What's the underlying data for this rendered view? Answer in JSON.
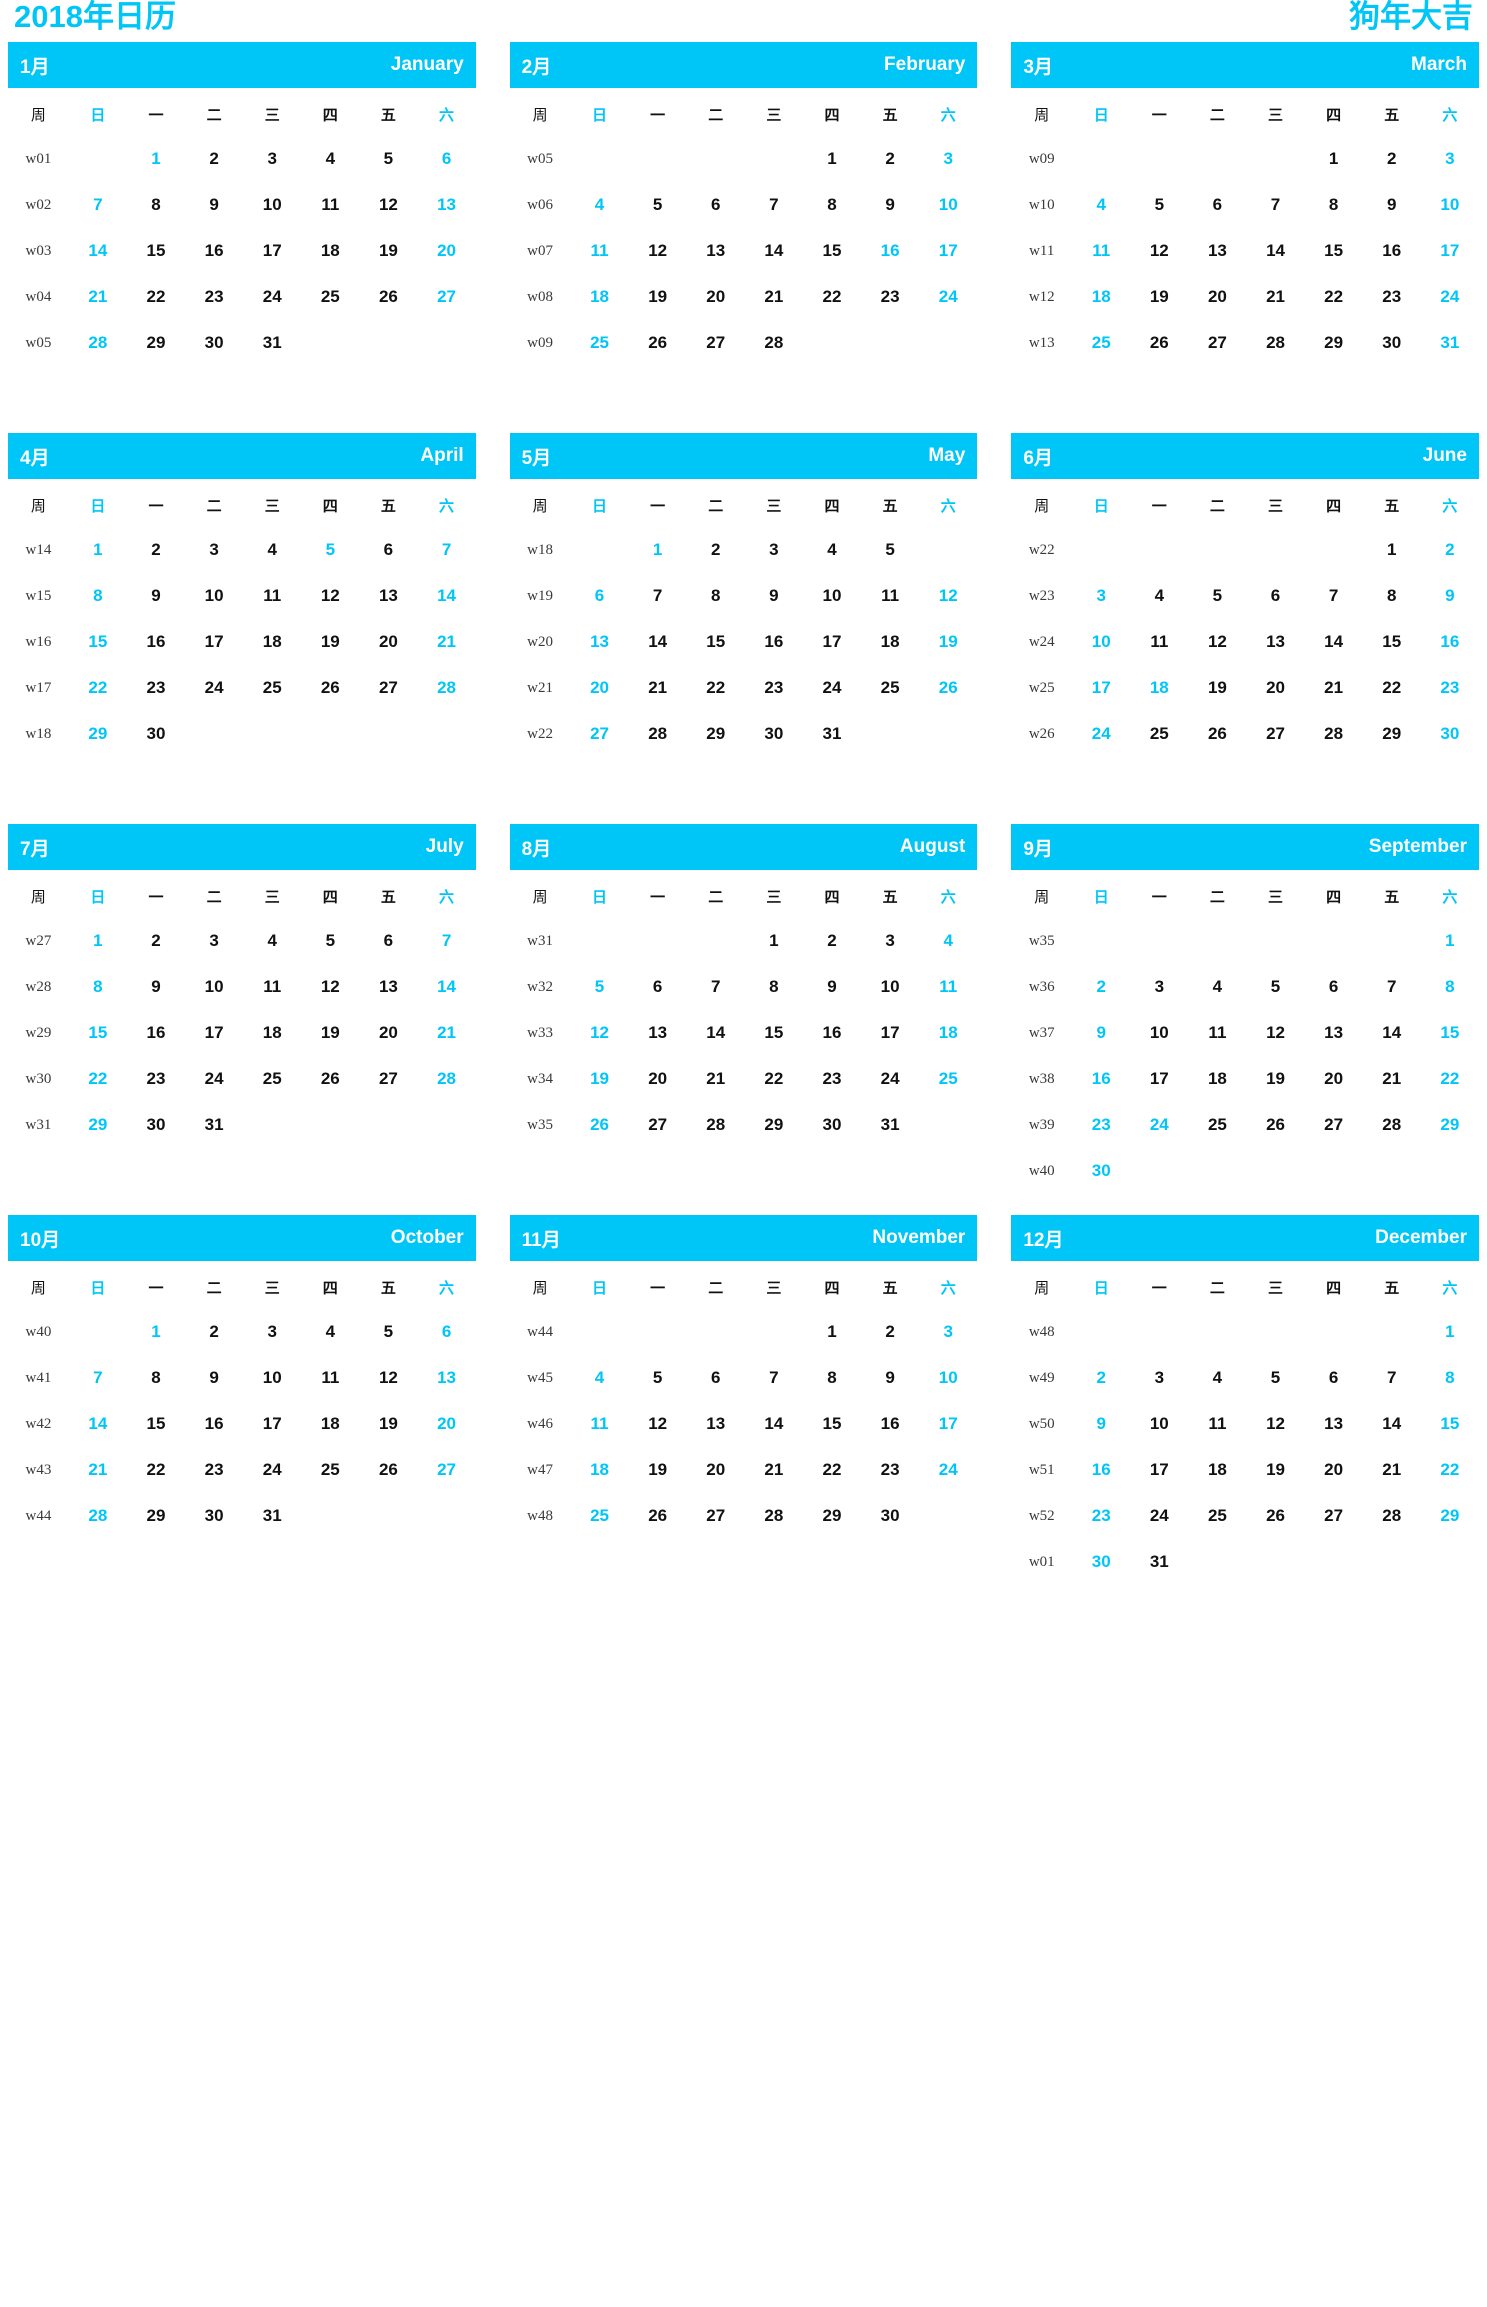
{
  "header": {
    "title_left": "2018年日历",
    "title_right": "狗年大吉",
    "accent_color": "#00c6f8",
    "text_color": "#111111",
    "weeknum_color": "#3a3a3a"
  },
  "weekday_headers": {
    "week_label": "周",
    "days": [
      "日",
      "一",
      "二",
      "三",
      "四",
      "五",
      "六"
    ],
    "weekend_indexes": [
      0,
      6
    ]
  },
  "months": [
    {
      "cn": "1月",
      "en": "January",
      "weeks": [
        {
          "w": "w01",
          "days": [
            "",
            "1",
            "2",
            "3",
            "4",
            "5",
            "6"
          ],
          "holidays": [
            1
          ]
        },
        {
          "w": "w02",
          "days": [
            "7",
            "8",
            "9",
            "10",
            "11",
            "12",
            "13"
          ],
          "holidays": []
        },
        {
          "w": "w03",
          "days": [
            "14",
            "15",
            "16",
            "17",
            "18",
            "19",
            "20"
          ],
          "holidays": []
        },
        {
          "w": "w04",
          "days": [
            "21",
            "22",
            "23",
            "24",
            "25",
            "26",
            "27"
          ],
          "holidays": []
        },
        {
          "w": "w05",
          "days": [
            "28",
            "29",
            "30",
            "31",
            "",
            "",
            ""
          ],
          "holidays": []
        }
      ]
    },
    {
      "cn": "2月",
      "en": "February",
      "weeks": [
        {
          "w": "w05",
          "days": [
            "",
            "",
            "",
            "",
            "1",
            "2",
            "3"
          ],
          "holidays": []
        },
        {
          "w": "w06",
          "days": [
            "4",
            "5",
            "6",
            "7",
            "8",
            "9",
            "10"
          ],
          "holidays": []
        },
        {
          "w": "w07",
          "days": [
            "11",
            "12",
            "13",
            "14",
            "15",
            "16",
            "17"
          ],
          "holidays": [
            5
          ]
        },
        {
          "w": "w08",
          "days": [
            "18",
            "19",
            "20",
            "21",
            "22",
            "23",
            "24"
          ],
          "holidays": []
        },
        {
          "w": "w09",
          "days": [
            "25",
            "26",
            "27",
            "28",
            "",
            "",
            ""
          ],
          "holidays": []
        }
      ]
    },
    {
      "cn": "3月",
      "en": "March",
      "weeks": [
        {
          "w": "w09",
          "days": [
            "",
            "",
            "",
            "",
            "1",
            "2",
            "3"
          ],
          "holidays": []
        },
        {
          "w": "w10",
          "days": [
            "4",
            "5",
            "6",
            "7",
            "8",
            "9",
            "10"
          ],
          "holidays": []
        },
        {
          "w": "w11",
          "days": [
            "11",
            "12",
            "13",
            "14",
            "15",
            "16",
            "17"
          ],
          "holidays": []
        },
        {
          "w": "w12",
          "days": [
            "18",
            "19",
            "20",
            "21",
            "22",
            "23",
            "24"
          ],
          "holidays": []
        },
        {
          "w": "w13",
          "days": [
            "25",
            "26",
            "27",
            "28",
            "29",
            "30",
            "31"
          ],
          "holidays": []
        }
      ]
    },
    {
      "cn": "4月",
      "en": "April",
      "weeks": [
        {
          "w": "w14",
          "days": [
            "1",
            "2",
            "3",
            "4",
            "5",
            "6",
            "7"
          ],
          "holidays": [
            4
          ]
        },
        {
          "w": "w15",
          "days": [
            "8",
            "9",
            "10",
            "11",
            "12",
            "13",
            "14"
          ],
          "holidays": []
        },
        {
          "w": "w16",
          "days": [
            "15",
            "16",
            "17",
            "18",
            "19",
            "20",
            "21"
          ],
          "holidays": []
        },
        {
          "w": "w17",
          "days": [
            "22",
            "23",
            "24",
            "25",
            "26",
            "27",
            "28"
          ],
          "holidays": []
        },
        {
          "w": "w18",
          "days": [
            "29",
            "30",
            "",
            "",
            "",
            "",
            ""
          ],
          "holidays": []
        }
      ]
    },
    {
      "cn": "5月",
      "en": "May",
      "weeks": [
        {
          "w": "w18",
          "days": [
            "",
            "1",
            "2",
            "3",
            "4",
            "5",
            ""
          ],
          "holidays": [
            1
          ]
        },
        {
          "w": "w19",
          "days": [
            "6",
            "7",
            "8",
            "9",
            "10",
            "11",
            "12"
          ],
          "holidays": []
        },
        {
          "w": "w20",
          "days": [
            "13",
            "14",
            "15",
            "16",
            "17",
            "18",
            "19"
          ],
          "holidays": []
        },
        {
          "w": "w21",
          "days": [
            "20",
            "21",
            "22",
            "23",
            "24",
            "25",
            "26"
          ],
          "holidays": []
        },
        {
          "w": "w22",
          "days": [
            "27",
            "28",
            "29",
            "30",
            "31",
            "",
            ""
          ],
          "holidays": []
        }
      ]
    },
    {
      "cn": "6月",
      "en": "June",
      "weeks": [
        {
          "w": "w22",
          "days": [
            "",
            "",
            "",
            "",
            "",
            "1",
            "2"
          ],
          "holidays": []
        },
        {
          "w": "w23",
          "days": [
            "3",
            "4",
            "5",
            "6",
            "7",
            "8",
            "9"
          ],
          "holidays": []
        },
        {
          "w": "w24",
          "days": [
            "10",
            "11",
            "12",
            "13",
            "14",
            "15",
            "16"
          ],
          "holidays": []
        },
        {
          "w": "w25",
          "days": [
            "17",
            "18",
            "19",
            "20",
            "21",
            "22",
            "23"
          ],
          "holidays": [
            1
          ]
        },
        {
          "w": "w26",
          "days": [
            "24",
            "25",
            "26",
            "27",
            "28",
            "29",
            "30"
          ],
          "holidays": []
        }
      ]
    },
    {
      "cn": "7月",
      "en": "July",
      "weeks": [
        {
          "w": "w27",
          "days": [
            "1",
            "2",
            "3",
            "4",
            "5",
            "6",
            "7"
          ],
          "holidays": []
        },
        {
          "w": "w28",
          "days": [
            "8",
            "9",
            "10",
            "11",
            "12",
            "13",
            "14"
          ],
          "holidays": []
        },
        {
          "w": "w29",
          "days": [
            "15",
            "16",
            "17",
            "18",
            "19",
            "20",
            "21"
          ],
          "holidays": []
        },
        {
          "w": "w30",
          "days": [
            "22",
            "23",
            "24",
            "25",
            "26",
            "27",
            "28"
          ],
          "holidays": []
        },
        {
          "w": "w31",
          "days": [
            "29",
            "30",
            "31",
            "",
            "",
            "",
            ""
          ],
          "holidays": []
        }
      ]
    },
    {
      "cn": "8月",
      "en": "August",
      "weeks": [
        {
          "w": "w31",
          "days": [
            "",
            "",
            "",
            "1",
            "2",
            "3",
            "4"
          ],
          "holidays": []
        },
        {
          "w": "w32",
          "days": [
            "5",
            "6",
            "7",
            "8",
            "9",
            "10",
            "11"
          ],
          "holidays": []
        },
        {
          "w": "w33",
          "days": [
            "12",
            "13",
            "14",
            "15",
            "16",
            "17",
            "18"
          ],
          "holidays": []
        },
        {
          "w": "w34",
          "days": [
            "19",
            "20",
            "21",
            "22",
            "23",
            "24",
            "25"
          ],
          "holidays": []
        },
        {
          "w": "w35",
          "days": [
            "26",
            "27",
            "28",
            "29",
            "30",
            "31",
            ""
          ],
          "holidays": []
        }
      ]
    },
    {
      "cn": "9月",
      "en": "September",
      "weeks": [
        {
          "w": "w35",
          "days": [
            "",
            "",
            "",
            "",
            "",
            "",
            "1"
          ],
          "holidays": []
        },
        {
          "w": "w36",
          "days": [
            "2",
            "3",
            "4",
            "5",
            "6",
            "7",
            "8"
          ],
          "holidays": []
        },
        {
          "w": "w37",
          "days": [
            "9",
            "10",
            "11",
            "12",
            "13",
            "14",
            "15"
          ],
          "holidays": []
        },
        {
          "w": "w38",
          "days": [
            "16",
            "17",
            "18",
            "19",
            "20",
            "21",
            "22"
          ],
          "holidays": []
        },
        {
          "w": "w39",
          "days": [
            "23",
            "24",
            "25",
            "26",
            "27",
            "28",
            "29"
          ],
          "holidays": [
            1
          ]
        },
        {
          "w": "w40",
          "days": [
            "30",
            "",
            "",
            "",
            "",
            "",
            ""
          ],
          "holidays": []
        }
      ]
    },
    {
      "cn": "10月",
      "en": "October",
      "weeks": [
        {
          "w": "w40",
          "days": [
            "",
            "1",
            "2",
            "3",
            "4",
            "5",
            "6"
          ],
          "holidays": [
            1
          ]
        },
        {
          "w": "w41",
          "days": [
            "7",
            "8",
            "9",
            "10",
            "11",
            "12",
            "13"
          ],
          "holidays": []
        },
        {
          "w": "w42",
          "days": [
            "14",
            "15",
            "16",
            "17",
            "18",
            "19",
            "20"
          ],
          "holidays": []
        },
        {
          "w": "w43",
          "days": [
            "21",
            "22",
            "23",
            "24",
            "25",
            "26",
            "27"
          ],
          "holidays": []
        },
        {
          "w": "w44",
          "days": [
            "28",
            "29",
            "30",
            "31",
            "",
            "",
            ""
          ],
          "holidays": []
        }
      ]
    },
    {
      "cn": "11月",
      "en": "November",
      "weeks": [
        {
          "w": "w44",
          "days": [
            "",
            "",
            "",
            "",
            "1",
            "2",
            "3"
          ],
          "holidays": []
        },
        {
          "w": "w45",
          "days": [
            "4",
            "5",
            "6",
            "7",
            "8",
            "9",
            "10"
          ],
          "holidays": []
        },
        {
          "w": "w46",
          "days": [
            "11",
            "12",
            "13",
            "14",
            "15",
            "16",
            "17"
          ],
          "holidays": []
        },
        {
          "w": "w47",
          "days": [
            "18",
            "19",
            "20",
            "21",
            "22",
            "23",
            "24"
          ],
          "holidays": []
        },
        {
          "w": "w48",
          "days": [
            "25",
            "26",
            "27",
            "28",
            "29",
            "30",
            ""
          ],
          "holidays": []
        }
      ]
    },
    {
      "cn": "12月",
      "en": "December",
      "weeks": [
        {
          "w": "w48",
          "days": [
            "",
            "",
            "",
            "",
            "",
            "",
            "1"
          ],
          "holidays": []
        },
        {
          "w": "w49",
          "days": [
            "2",
            "3",
            "4",
            "5",
            "6",
            "7",
            "8"
          ],
          "holidays": []
        },
        {
          "w": "w50",
          "days": [
            "9",
            "10",
            "11",
            "12",
            "13",
            "14",
            "15"
          ],
          "holidays": []
        },
        {
          "w": "w51",
          "days": [
            "16",
            "17",
            "18",
            "19",
            "20",
            "21",
            "22"
          ],
          "holidays": []
        },
        {
          "w": "w52",
          "days": [
            "23",
            "24",
            "25",
            "26",
            "27",
            "28",
            "29"
          ],
          "holidays": []
        },
        {
          "w": "w01",
          "days": [
            "30",
            "31",
            "",
            "",
            "",
            "",
            ""
          ],
          "holidays": []
        }
      ]
    }
  ]
}
